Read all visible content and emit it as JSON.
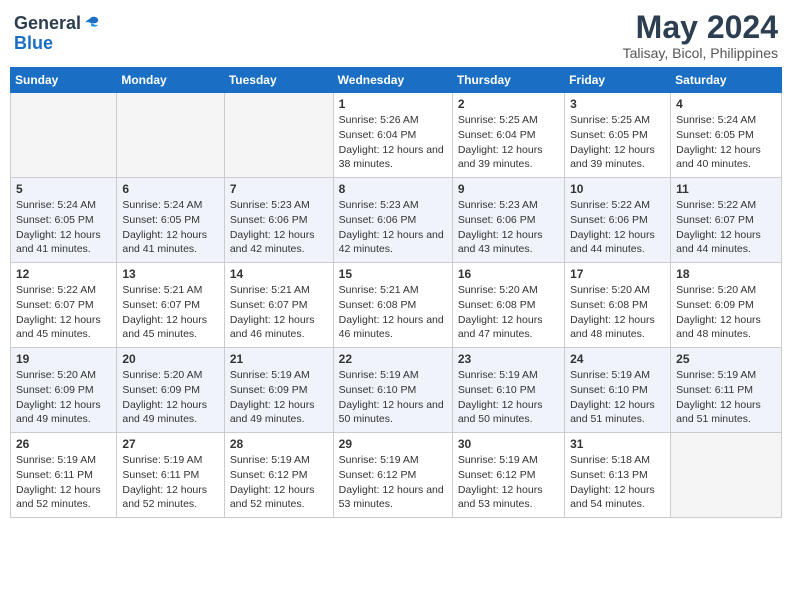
{
  "logo": {
    "line1": "General",
    "line2": "Blue"
  },
  "title": "May 2024",
  "subtitle": "Talisay, Bicol, Philippines",
  "days_of_week": [
    "Sunday",
    "Monday",
    "Tuesday",
    "Wednesday",
    "Thursday",
    "Friday",
    "Saturday"
  ],
  "weeks": [
    {
      "striped": false,
      "days": [
        {
          "num": "",
          "sunrise": "",
          "sunset": "",
          "daylight": "",
          "empty": true
        },
        {
          "num": "",
          "sunrise": "",
          "sunset": "",
          "daylight": "",
          "empty": true
        },
        {
          "num": "",
          "sunrise": "",
          "sunset": "",
          "daylight": "",
          "empty": true
        },
        {
          "num": "1",
          "sunrise": "Sunrise: 5:26 AM",
          "sunset": "Sunset: 6:04 PM",
          "daylight": "Daylight: 12 hours and 38 minutes."
        },
        {
          "num": "2",
          "sunrise": "Sunrise: 5:25 AM",
          "sunset": "Sunset: 6:04 PM",
          "daylight": "Daylight: 12 hours and 39 minutes."
        },
        {
          "num": "3",
          "sunrise": "Sunrise: 5:25 AM",
          "sunset": "Sunset: 6:05 PM",
          "daylight": "Daylight: 12 hours and 39 minutes."
        },
        {
          "num": "4",
          "sunrise": "Sunrise: 5:24 AM",
          "sunset": "Sunset: 6:05 PM",
          "daylight": "Daylight: 12 hours and 40 minutes."
        }
      ]
    },
    {
      "striped": true,
      "days": [
        {
          "num": "5",
          "sunrise": "Sunrise: 5:24 AM",
          "sunset": "Sunset: 6:05 PM",
          "daylight": "Daylight: 12 hours and 41 minutes."
        },
        {
          "num": "6",
          "sunrise": "Sunrise: 5:24 AM",
          "sunset": "Sunset: 6:05 PM",
          "daylight": "Daylight: 12 hours and 41 minutes."
        },
        {
          "num": "7",
          "sunrise": "Sunrise: 5:23 AM",
          "sunset": "Sunset: 6:06 PM",
          "daylight": "Daylight: 12 hours and 42 minutes."
        },
        {
          "num": "8",
          "sunrise": "Sunrise: 5:23 AM",
          "sunset": "Sunset: 6:06 PM",
          "daylight": "Daylight: 12 hours and 42 minutes."
        },
        {
          "num": "9",
          "sunrise": "Sunrise: 5:23 AM",
          "sunset": "Sunset: 6:06 PM",
          "daylight": "Daylight: 12 hours and 43 minutes."
        },
        {
          "num": "10",
          "sunrise": "Sunrise: 5:22 AM",
          "sunset": "Sunset: 6:06 PM",
          "daylight": "Daylight: 12 hours and 44 minutes."
        },
        {
          "num": "11",
          "sunrise": "Sunrise: 5:22 AM",
          "sunset": "Sunset: 6:07 PM",
          "daylight": "Daylight: 12 hours and 44 minutes."
        }
      ]
    },
    {
      "striped": false,
      "days": [
        {
          "num": "12",
          "sunrise": "Sunrise: 5:22 AM",
          "sunset": "Sunset: 6:07 PM",
          "daylight": "Daylight: 12 hours and 45 minutes."
        },
        {
          "num": "13",
          "sunrise": "Sunrise: 5:21 AM",
          "sunset": "Sunset: 6:07 PM",
          "daylight": "Daylight: 12 hours and 45 minutes."
        },
        {
          "num": "14",
          "sunrise": "Sunrise: 5:21 AM",
          "sunset": "Sunset: 6:07 PM",
          "daylight": "Daylight: 12 hours and 46 minutes."
        },
        {
          "num": "15",
          "sunrise": "Sunrise: 5:21 AM",
          "sunset": "Sunset: 6:08 PM",
          "daylight": "Daylight: 12 hours and 46 minutes."
        },
        {
          "num": "16",
          "sunrise": "Sunrise: 5:20 AM",
          "sunset": "Sunset: 6:08 PM",
          "daylight": "Daylight: 12 hours and 47 minutes."
        },
        {
          "num": "17",
          "sunrise": "Sunrise: 5:20 AM",
          "sunset": "Sunset: 6:08 PM",
          "daylight": "Daylight: 12 hours and 48 minutes."
        },
        {
          "num": "18",
          "sunrise": "Sunrise: 5:20 AM",
          "sunset": "Sunset: 6:09 PM",
          "daylight": "Daylight: 12 hours and 48 minutes."
        }
      ]
    },
    {
      "striped": true,
      "days": [
        {
          "num": "19",
          "sunrise": "Sunrise: 5:20 AM",
          "sunset": "Sunset: 6:09 PM",
          "daylight": "Daylight: 12 hours and 49 minutes."
        },
        {
          "num": "20",
          "sunrise": "Sunrise: 5:20 AM",
          "sunset": "Sunset: 6:09 PM",
          "daylight": "Daylight: 12 hours and 49 minutes."
        },
        {
          "num": "21",
          "sunrise": "Sunrise: 5:19 AM",
          "sunset": "Sunset: 6:09 PM",
          "daylight": "Daylight: 12 hours and 49 minutes."
        },
        {
          "num": "22",
          "sunrise": "Sunrise: 5:19 AM",
          "sunset": "Sunset: 6:10 PM",
          "daylight": "Daylight: 12 hours and 50 minutes."
        },
        {
          "num": "23",
          "sunrise": "Sunrise: 5:19 AM",
          "sunset": "Sunset: 6:10 PM",
          "daylight": "Daylight: 12 hours and 50 minutes."
        },
        {
          "num": "24",
          "sunrise": "Sunrise: 5:19 AM",
          "sunset": "Sunset: 6:10 PM",
          "daylight": "Daylight: 12 hours and 51 minutes."
        },
        {
          "num": "25",
          "sunrise": "Sunrise: 5:19 AM",
          "sunset": "Sunset: 6:11 PM",
          "daylight": "Daylight: 12 hours and 51 minutes."
        }
      ]
    },
    {
      "striped": false,
      "days": [
        {
          "num": "26",
          "sunrise": "Sunrise: 5:19 AM",
          "sunset": "Sunset: 6:11 PM",
          "daylight": "Daylight: 12 hours and 52 minutes."
        },
        {
          "num": "27",
          "sunrise": "Sunrise: 5:19 AM",
          "sunset": "Sunset: 6:11 PM",
          "daylight": "Daylight: 12 hours and 52 minutes."
        },
        {
          "num": "28",
          "sunrise": "Sunrise: 5:19 AM",
          "sunset": "Sunset: 6:12 PM",
          "daylight": "Daylight: 12 hours and 52 minutes."
        },
        {
          "num": "29",
          "sunrise": "Sunrise: 5:19 AM",
          "sunset": "Sunset: 6:12 PM",
          "daylight": "Daylight: 12 hours and 53 minutes."
        },
        {
          "num": "30",
          "sunrise": "Sunrise: 5:19 AM",
          "sunset": "Sunset: 6:12 PM",
          "daylight": "Daylight: 12 hours and 53 minutes."
        },
        {
          "num": "31",
          "sunrise": "Sunrise: 5:18 AM",
          "sunset": "Sunset: 6:13 PM",
          "daylight": "Daylight: 12 hours and 54 minutes."
        },
        {
          "num": "",
          "sunrise": "",
          "sunset": "",
          "daylight": "",
          "empty": true
        }
      ]
    }
  ]
}
